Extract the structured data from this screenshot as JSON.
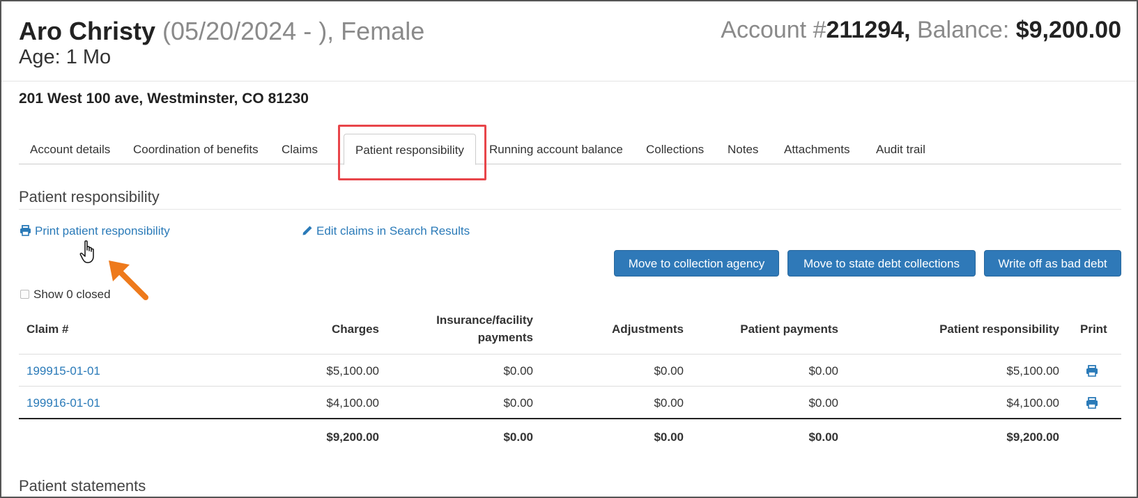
{
  "patient": {
    "name": "Aro Christy",
    "dob_sex": " (05/20/2024 - ), Female",
    "age": "Age: 1 Mo",
    "account_label": "Account #",
    "account_number": "211294,",
    "balance_label": " Balance: ",
    "balance": "$9,200.00",
    "address": "201 West 100 ave, Westminster, CO 81230"
  },
  "tabs": [
    {
      "label": "Account details"
    },
    {
      "label": "Coordination of benefits"
    },
    {
      "label": "Claims"
    },
    {
      "label": "Patient responsibility",
      "active": true
    },
    {
      "label": "Running account balance"
    },
    {
      "label": "Collections"
    },
    {
      "label": "Notes"
    },
    {
      "label": "Attachments"
    },
    {
      "label": "Audit trail"
    }
  ],
  "section": {
    "title": "Patient responsibility",
    "print_link": "Print patient responsibility",
    "edit_link": "Edit claims in Search Results",
    "buttons": {
      "collection_agency": "Move to collection agency",
      "state_debt": "Move to state debt collections",
      "write_off": "Write off as bad debt"
    },
    "show_closed": "Show 0 closed"
  },
  "table": {
    "headers": {
      "claim": "Claim #",
      "charges": "Charges",
      "insurance_1": "Insurance/facility",
      "insurance_2": "payments",
      "adjustments": "Adjustments",
      "patient_payments": "Patient payments",
      "patient_responsibility": "Patient responsibility",
      "print": "Print"
    },
    "rows": [
      {
        "claim": "199915-01-01",
        "charges": "$5,100.00",
        "insurance": "$0.00",
        "adjustments": "$0.00",
        "patient_payments": "$0.00",
        "patient_responsibility": "$5,100.00"
      },
      {
        "claim": "199916-01-01",
        "charges": "$4,100.00",
        "insurance": "$0.00",
        "adjustments": "$0.00",
        "patient_payments": "$0.00",
        "patient_responsibility": "$4,100.00"
      }
    ],
    "totals": {
      "charges": "$9,200.00",
      "insurance": "$0.00",
      "adjustments": "$0.00",
      "patient_payments": "$0.00",
      "patient_responsibility": "$9,200.00"
    }
  },
  "statements_title": "Patient statements",
  "colors": {
    "link": "#2a7ab8",
    "button": "#2f79b8",
    "highlight": "#e8454a",
    "arrow": "#ee7a1c"
  }
}
